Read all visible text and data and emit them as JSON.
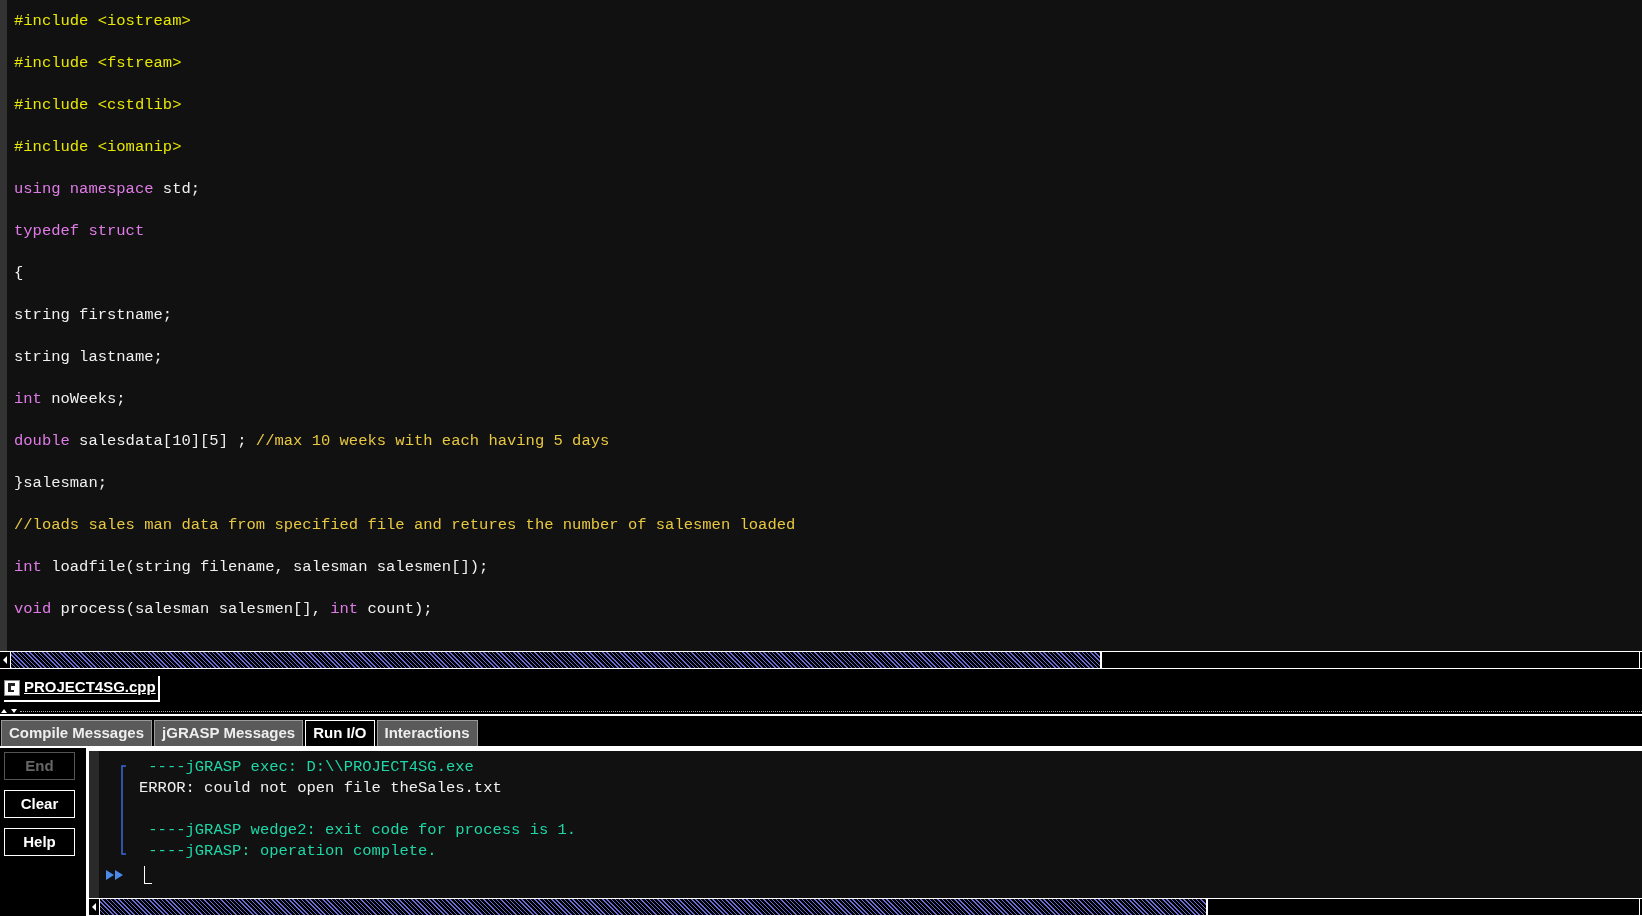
{
  "code_lines": [
    [
      {
        "kind": "preprocessor",
        "text": "#include <iostream>"
      }
    ],
    [
      {
        "kind": "preprocessor",
        "text": "#include <fstream>"
      }
    ],
    [
      {
        "kind": "preprocessor",
        "text": "#include <cstdlib>"
      }
    ],
    [
      {
        "kind": "preprocessor",
        "text": "#include <iomanip>"
      }
    ],
    [
      {
        "kind": "keyword",
        "text": "using namespace"
      },
      {
        "kind": "plain",
        "text": " std;"
      }
    ],
    [
      {
        "kind": "keyword",
        "text": "typedef struct"
      }
    ],
    [
      {
        "kind": "plain",
        "text": "{"
      }
    ],
    [
      {
        "kind": "plain",
        "text": "string firstname;"
      }
    ],
    [
      {
        "kind": "plain",
        "text": "string lastname;"
      }
    ],
    [
      {
        "kind": "keyword",
        "text": "int"
      },
      {
        "kind": "plain",
        "text": " noWeeks;"
      }
    ],
    [
      {
        "kind": "keyword",
        "text": "double"
      },
      {
        "kind": "plain",
        "text": " salesdata[10][5] ; "
      },
      {
        "kind": "comment",
        "text": "//max 10 weeks with each having 5 days"
      }
    ],
    [
      {
        "kind": "plain",
        "text": "}salesman;"
      }
    ],
    [
      {
        "kind": "comment",
        "text": "//loads sales man data from specified file and retures the number of salesmen loaded"
      }
    ],
    [
      {
        "kind": "keyword",
        "text": "int"
      },
      {
        "kind": "plain",
        "text": " loadfile(string filename, salesman salesmen[]);"
      }
    ],
    [
      {
        "kind": "keyword",
        "text": "void"
      },
      {
        "kind": "plain",
        "text": " process(salesman salesmen[], "
      },
      {
        "kind": "keyword",
        "text": "int"
      },
      {
        "kind": "plain",
        "text": " count);"
      }
    ]
  ],
  "file_tab": {
    "label": "PROJECT4SG.cpp",
    "selected": true
  },
  "tabs": [
    {
      "label": "Compile Messages",
      "selected": false
    },
    {
      "label": "jGRASP Messages",
      "selected": false
    },
    {
      "label": "Run I/O",
      "selected": true
    },
    {
      "label": "Interactions",
      "selected": false
    }
  ],
  "buttons": [
    {
      "label": "End",
      "disabled": true
    },
    {
      "label": "Clear",
      "disabled": false
    },
    {
      "label": "Help",
      "disabled": false
    }
  ],
  "output_lines": [
    {
      "kind": "system",
      "text": " ----jGRASP exec: D:\\\\PROJECT4SG.exe"
    },
    {
      "kind": "program",
      "text": "ERROR: could not open file theSales.txt"
    },
    {
      "kind": "blank"
    },
    {
      "kind": "system",
      "text": " ----jGRASP wedge2: exit code for process is 1."
    },
    {
      "kind": "system",
      "text": " ----jGRASP: operation complete."
    }
  ]
}
